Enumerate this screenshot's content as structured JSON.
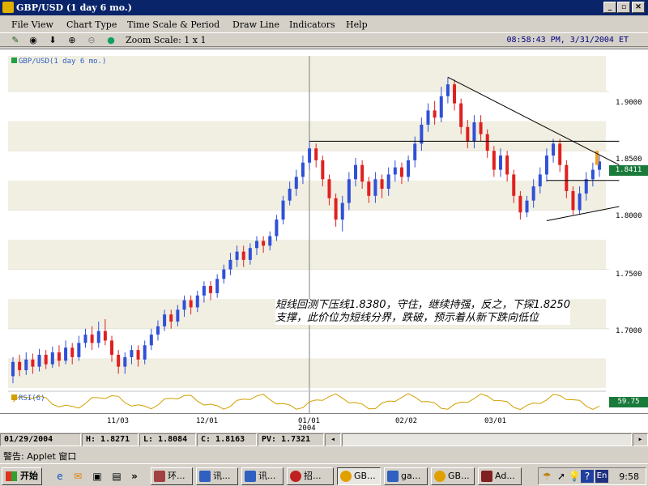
{
  "window": {
    "title": "GBP/USD (1 day  6 mo.)",
    "min": "_",
    "max": "▫",
    "close": "✕"
  },
  "menu": [
    "File View",
    "Chart Type",
    "Time Scale & Period",
    "Draw Line",
    "Indicators",
    "Help"
  ],
  "toolbar": {
    "zoom": "Zoom Scale: 1 x 1",
    "clock": "08:58:43 PM, 3/31/2004 ET",
    "icons": [
      "pencil-icon",
      "target-icon",
      "arrow-down-icon",
      "zoom-in-icon",
      "zoom-out-icon",
      "reset-icon"
    ]
  },
  "chart_data": {
    "type": "candlestick",
    "legend": "GBP/USD(1 day  6 mo.)",
    "indicator_legend": "RSI(6)",
    "rsi_value": "59.75",
    "last_price": "1.8411",
    "ylim": [
      1.65,
      1.93
    ],
    "y_ticks": [
      "1.9000",
      "1.8500",
      "1.8000",
      "1.7500",
      "1.7000"
    ],
    "y_tick_values": [
      1.9,
      1.85,
      1.8,
      1.75,
      1.7
    ],
    "x_ticks": [
      "11/03",
      "12/01",
      "01/01",
      "02/02",
      "03/01"
    ],
    "x_year": "2004",
    "annotation": [
      "短线回测下压线1.8380，守住，继续持强，反之，下探1.8250",
      "支撑，此价位为短线分界，跌破，预示着从新下跌向低位"
    ],
    "candles": [
      {
        "o": 1.66,
        "c": 1.672,
        "h": 1.676,
        "l": 1.654
      },
      {
        "o": 1.672,
        "c": 1.665,
        "h": 1.678,
        "l": 1.66
      },
      {
        "o": 1.665,
        "c": 1.674,
        "h": 1.68,
        "l": 1.661
      },
      {
        "o": 1.674,
        "c": 1.668,
        "h": 1.679,
        "l": 1.662
      },
      {
        "o": 1.668,
        "c": 1.678,
        "h": 1.683,
        "l": 1.664
      },
      {
        "o": 1.678,
        "c": 1.67,
        "h": 1.682,
        "l": 1.666
      },
      {
        "o": 1.67,
        "c": 1.68,
        "h": 1.685,
        "l": 1.667
      },
      {
        "o": 1.68,
        "c": 1.673,
        "h": 1.686,
        "l": 1.668
      },
      {
        "o": 1.673,
        "c": 1.684,
        "h": 1.69,
        "l": 1.67
      },
      {
        "o": 1.684,
        "c": 1.676,
        "h": 1.688,
        "l": 1.67
      },
      {
        "o": 1.676,
        "c": 1.688,
        "h": 1.694,
        "l": 1.673
      },
      {
        "o": 1.688,
        "c": 1.695,
        "h": 1.7,
        "l": 1.684
      },
      {
        "o": 1.695,
        "c": 1.688,
        "h": 1.702,
        "l": 1.682
      },
      {
        "o": 1.688,
        "c": 1.698,
        "h": 1.706,
        "l": 1.684
      },
      {
        "o": 1.698,
        "c": 1.69,
        "h": 1.708,
        "l": 1.686
      },
      {
        "o": 1.69,
        "c": 1.678,
        "h": 1.694,
        "l": 1.672
      },
      {
        "o": 1.678,
        "c": 1.668,
        "h": 1.682,
        "l": 1.662
      },
      {
        "o": 1.668,
        "c": 1.676,
        "h": 1.68,
        "l": 1.662
      },
      {
        "o": 1.676,
        "c": 1.682,
        "h": 1.686,
        "l": 1.67
      },
      {
        "o": 1.682,
        "c": 1.674,
        "h": 1.686,
        "l": 1.668
      },
      {
        "o": 1.674,
        "c": 1.686,
        "h": 1.69,
        "l": 1.67
      },
      {
        "o": 1.686,
        "c": 1.695,
        "h": 1.7,
        "l": 1.682
      },
      {
        "o": 1.695,
        "c": 1.702,
        "h": 1.707,
        "l": 1.69
      },
      {
        "o": 1.702,
        "c": 1.712,
        "h": 1.716,
        "l": 1.698
      },
      {
        "o": 1.712,
        "c": 1.706,
        "h": 1.716,
        "l": 1.7
      },
      {
        "o": 1.706,
        "c": 1.716,
        "h": 1.72,
        "l": 1.702
      },
      {
        "o": 1.716,
        "c": 1.724,
        "h": 1.728,
        "l": 1.71
      },
      {
        "o": 1.724,
        "c": 1.718,
        "h": 1.728,
        "l": 1.712
      },
      {
        "o": 1.718,
        "c": 1.728,
        "h": 1.732,
        "l": 1.714
      },
      {
        "o": 1.728,
        "c": 1.736,
        "h": 1.74,
        "l": 1.722
      },
      {
        "o": 1.736,
        "c": 1.73,
        "h": 1.74,
        "l": 1.724
      },
      {
        "o": 1.73,
        "c": 1.742,
        "h": 1.746,
        "l": 1.726
      },
      {
        "o": 1.742,
        "c": 1.75,
        "h": 1.754,
        "l": 1.738
      },
      {
        "o": 1.75,
        "c": 1.758,
        "h": 1.764,
        "l": 1.745
      },
      {
        "o": 1.758,
        "c": 1.765,
        "h": 1.77,
        "l": 1.752
      },
      {
        "o": 1.765,
        "c": 1.758,
        "h": 1.77,
        "l": 1.752
      },
      {
        "o": 1.758,
        "c": 1.768,
        "h": 1.772,
        "l": 1.754
      },
      {
        "o": 1.768,
        "c": 1.774,
        "h": 1.778,
        "l": 1.762
      },
      {
        "o": 1.774,
        "c": 1.77,
        "h": 1.778,
        "l": 1.764
      },
      {
        "o": 1.77,
        "c": 1.778,
        "h": 1.782,
        "l": 1.766
      },
      {
        "o": 1.778,
        "c": 1.792,
        "h": 1.796,
        "l": 1.774
      },
      {
        "o": 1.792,
        "c": 1.808,
        "h": 1.812,
        "l": 1.788
      },
      {
        "o": 1.808,
        "c": 1.818,
        "h": 1.824,
        "l": 1.804
      },
      {
        "o": 1.818,
        "c": 1.828,
        "h": 1.834,
        "l": 1.812
      },
      {
        "o": 1.828,
        "c": 1.84,
        "h": 1.846,
        "l": 1.822
      },
      {
        "o": 1.84,
        "c": 1.852,
        "h": 1.858,
        "l": 1.834
      },
      {
        "o": 1.852,
        "c": 1.842,
        "h": 1.856,
        "l": 1.836
      },
      {
        "o": 1.842,
        "c": 1.826,
        "h": 1.846,
        "l": 1.82
      },
      {
        "o": 1.826,
        "c": 1.81,
        "h": 1.83,
        "l": 1.804
      },
      {
        "o": 1.81,
        "c": 1.792,
        "h": 1.814,
        "l": 1.786
      },
      {
        "o": 1.792,
        "c": 1.806,
        "h": 1.812,
        "l": 1.782
      },
      {
        "o": 1.806,
        "c": 1.826,
        "h": 1.832,
        "l": 1.8
      },
      {
        "o": 1.826,
        "c": 1.838,
        "h": 1.844,
        "l": 1.82
      },
      {
        "o": 1.838,
        "c": 1.824,
        "h": 1.842,
        "l": 1.818
      },
      {
        "o": 1.824,
        "c": 1.812,
        "h": 1.828,
        "l": 1.806
      },
      {
        "o": 1.812,
        "c": 1.826,
        "h": 1.832,
        "l": 1.806
      },
      {
        "o": 1.826,
        "c": 1.818,
        "h": 1.83,
        "l": 1.81
      },
      {
        "o": 1.818,
        "c": 1.83,
        "h": 1.836,
        "l": 1.812
      },
      {
        "o": 1.83,
        "c": 1.836,
        "h": 1.842,
        "l": 1.824
      },
      {
        "o": 1.836,
        "c": 1.828,
        "h": 1.84,
        "l": 1.822
      },
      {
        "o": 1.828,
        "c": 1.842,
        "h": 1.846,
        "l": 1.824
      },
      {
        "o": 1.842,
        "c": 1.856,
        "h": 1.862,
        "l": 1.836
      },
      {
        "o": 1.856,
        "c": 1.872,
        "h": 1.878,
        "l": 1.85
      },
      {
        "o": 1.872,
        "c": 1.884,
        "h": 1.89,
        "l": 1.866
      },
      {
        "o": 1.884,
        "c": 1.878,
        "h": 1.892,
        "l": 1.872
      },
      {
        "o": 1.878,
        "c": 1.896,
        "h": 1.904,
        "l": 1.874
      },
      {
        "o": 1.896,
        "c": 1.906,
        "h": 1.912,
        "l": 1.89
      },
      {
        "o": 1.906,
        "c": 1.89,
        "h": 1.91,
        "l": 1.884
      },
      {
        "o": 1.89,
        "c": 1.87,
        "h": 1.894,
        "l": 1.864
      },
      {
        "o": 1.87,
        "c": 1.858,
        "h": 1.876,
        "l": 1.852
      },
      {
        "o": 1.858,
        "c": 1.874,
        "h": 1.88,
        "l": 1.852
      },
      {
        "o": 1.874,
        "c": 1.864,
        "h": 1.88,
        "l": 1.858
      },
      {
        "o": 1.864,
        "c": 1.85,
        "h": 1.868,
        "l": 1.844
      },
      {
        "o": 1.85,
        "c": 1.834,
        "h": 1.854,
        "l": 1.828
      },
      {
        "o": 1.834,
        "c": 1.846,
        "h": 1.852,
        "l": 1.828
      },
      {
        "o": 1.846,
        "c": 1.83,
        "h": 1.85,
        "l": 1.824
      },
      {
        "o": 1.83,
        "c": 1.812,
        "h": 1.834,
        "l": 1.806
      },
      {
        "o": 1.812,
        "c": 1.798,
        "h": 1.816,
        "l": 1.792
      },
      {
        "o": 1.798,
        "c": 1.808,
        "h": 1.812,
        "l": 1.794
      },
      {
        "o": 1.808,
        "c": 1.82,
        "h": 1.826,
        "l": 1.802
      },
      {
        "o": 1.82,
        "c": 1.83,
        "h": 1.836,
        "l": 1.814
      },
      {
        "o": 1.83,
        "c": 1.846,
        "h": 1.852,
        "l": 1.824
      },
      {
        "o": 1.846,
        "c": 1.856,
        "h": 1.86,
        "l": 1.84
      },
      {
        "o": 1.856,
        "c": 1.838,
        "h": 1.86,
        "l": 1.832
      },
      {
        "o": 1.838,
        "c": 1.816,
        "h": 1.842,
        "l": 1.81
      },
      {
        "o": 1.816,
        "c": 1.8,
        "h": 1.82,
        "l": 1.796
      },
      {
        "o": 1.8,
        "c": 1.814,
        "h": 1.82,
        "l": 1.796
      },
      {
        "o": 1.814,
        "c": 1.826,
        "h": 1.832,
        "l": 1.808
      },
      {
        "o": 1.826,
        "c": 1.834,
        "h": 1.84,
        "l": 1.82
      },
      {
        "o": 1.834,
        "c": 1.841,
        "h": 1.846,
        "l": 1.828
      }
    ]
  },
  "status": {
    "date": "01/29/2004",
    "high": "H: 1.8271",
    "low": "L: 1.8084",
    "close": "C: 1.8163",
    "pv": "PV: 1.7321"
  },
  "warning": "警告: Applet 窗口",
  "taskbar": {
    "start": "开始",
    "tasks": [
      "环...",
      "讯...",
      "讯...",
      "招...",
      "GB...",
      "ga...",
      "GB...",
      "Ad..."
    ],
    "time": "9:58"
  }
}
